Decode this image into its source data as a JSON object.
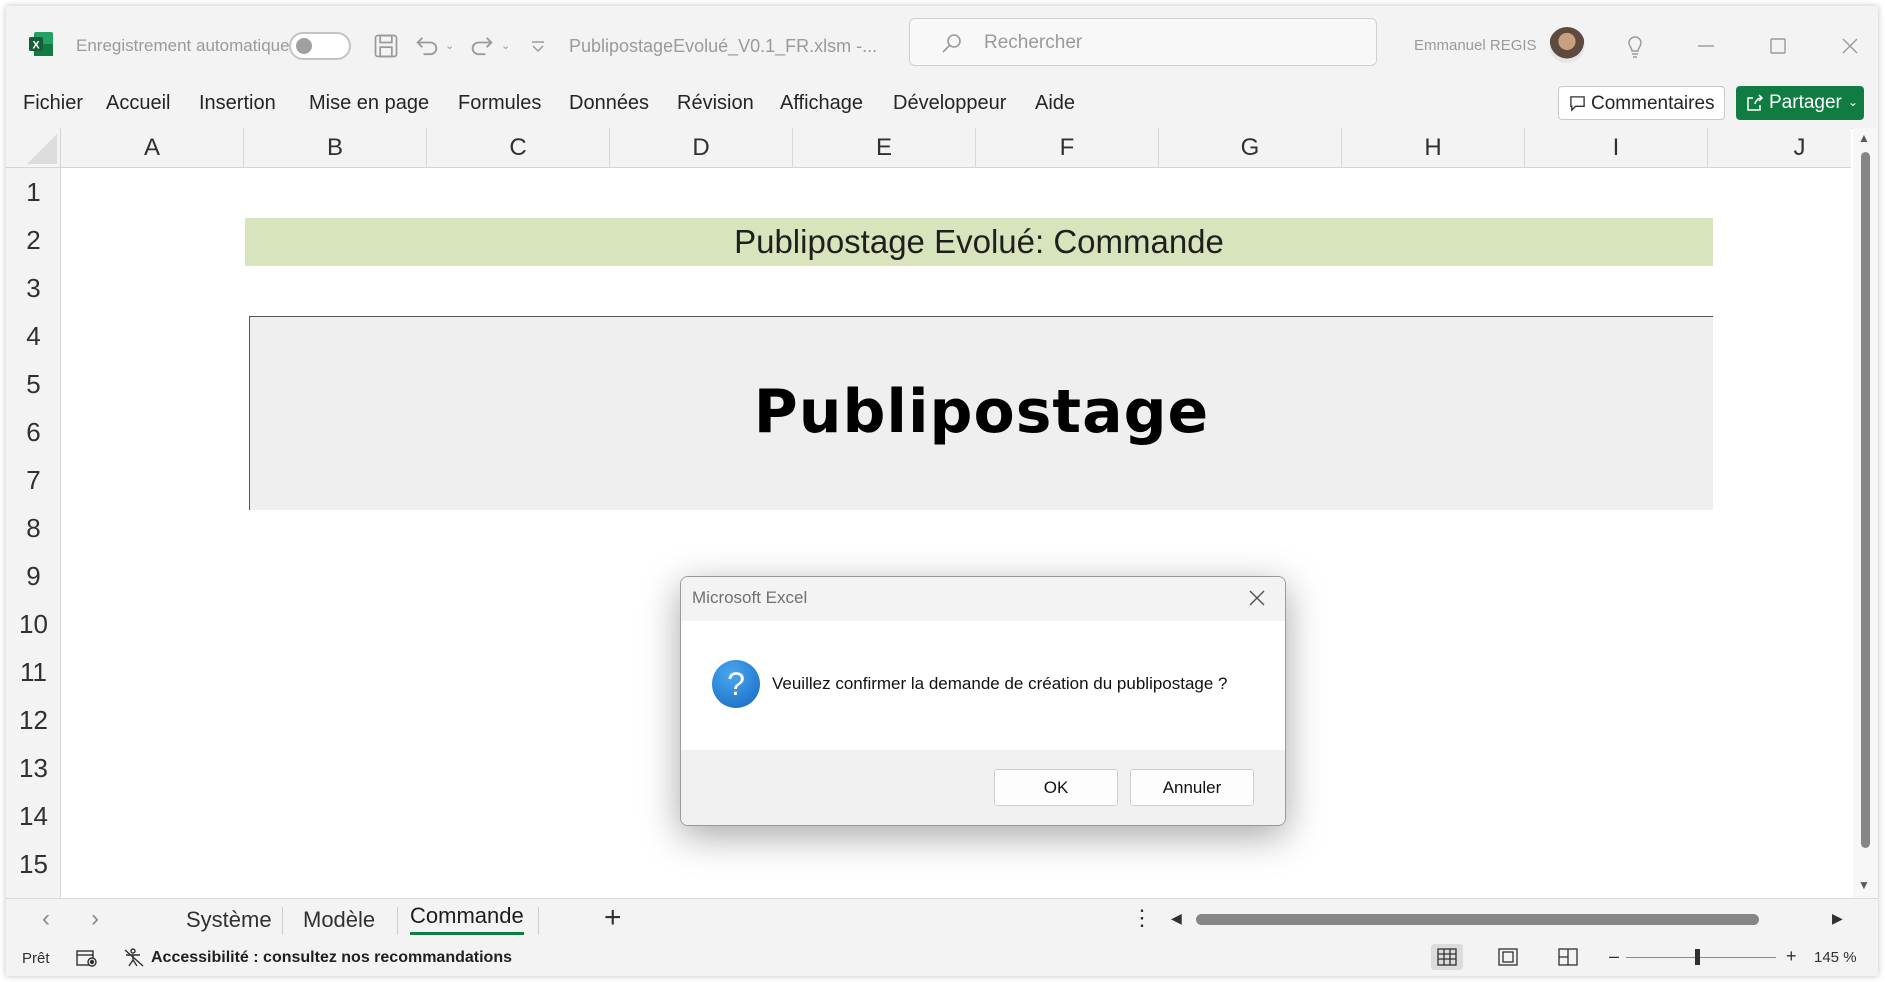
{
  "titlebar": {
    "autosave_label": "Enregistrement automatique",
    "filename": "PublipostageEvolué_V0.1_FR.xlsm  -...",
    "search_placeholder": "Rechercher",
    "user_name": "Emmanuel REGIS"
  },
  "ribbon": {
    "tabs": [
      "Fichier",
      "Accueil",
      "Insertion",
      "Mise en page",
      "Formules",
      "Données",
      "Révision",
      "Affichage",
      "Développeur",
      "Aide"
    ],
    "comments_label": "Commentaires",
    "share_label": "Partager"
  },
  "grid": {
    "columns": [
      "A",
      "B",
      "C",
      "D",
      "E",
      "F",
      "G",
      "H",
      "I",
      "J"
    ],
    "rows": [
      "1",
      "2",
      "3",
      "4",
      "5",
      "6",
      "7",
      "8",
      "9",
      "10",
      "11",
      "12",
      "13",
      "14",
      "15"
    ],
    "banner_text": "Publipostage Evolué: Commande",
    "box_text": "Publipostage"
  },
  "sheets": {
    "tabs": [
      "Système",
      "Modèle",
      "Commande"
    ],
    "active": "Commande",
    "add_symbol": "+"
  },
  "status": {
    "ready": "Prêt",
    "accessibility": "Accessibilité : consultez nos recommandations",
    "zoom": "145 %",
    "zoom_fraction": 0.47
  },
  "dialog": {
    "title": "Microsoft Excel",
    "message": "Veuillez confirmer la demande de création du publipostage ?",
    "ok_label": "OK",
    "cancel_label": "Annuler",
    "icon_glyph": "?"
  },
  "colors": {
    "accent": "#107c41",
    "banner_fill": "#d8e4bc",
    "box_fill": "#efefef",
    "question_icon": "#1e88e5"
  }
}
